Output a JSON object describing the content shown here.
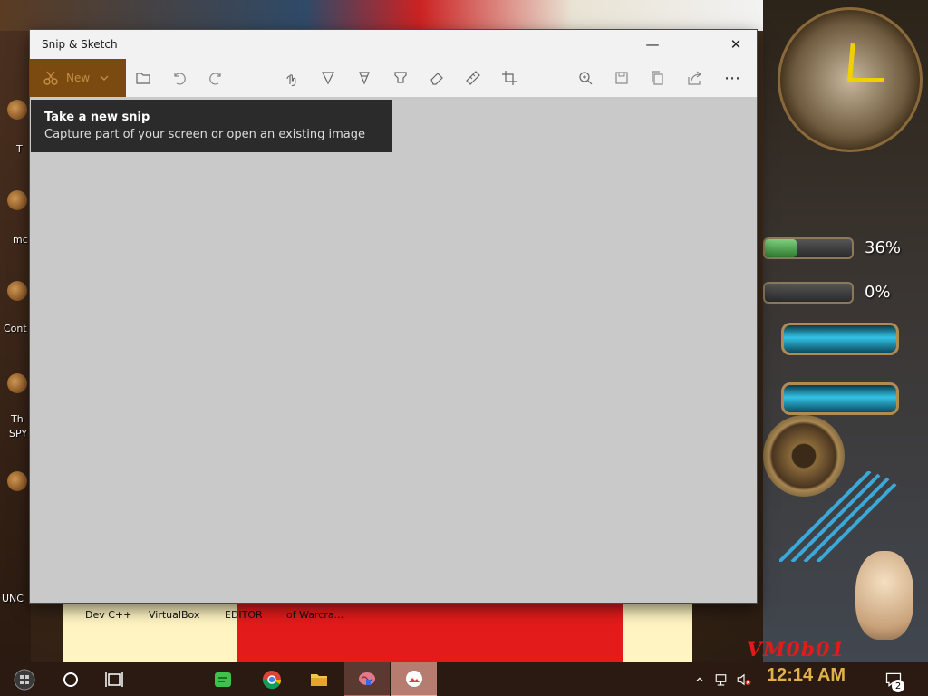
{
  "window": {
    "title": "Snip & Sketch",
    "minimize_symbol": "—",
    "close_symbol": "✕"
  },
  "toolbar": {
    "new_label": "New",
    "more_symbol": "⋯",
    "icons": [
      "open-file-icon",
      "undo-icon",
      "redo-icon",
      "touch-writing-icon",
      "ballpoint-pen-icon",
      "pencil-icon",
      "highlighter-icon",
      "eraser-icon",
      "ruler-icon",
      "crop-icon",
      "zoom-icon",
      "save-icon",
      "copy-icon",
      "share-icon",
      "more-icon"
    ]
  },
  "tooltip": {
    "title": "Take a new snip",
    "description": "Capture part of your screen or open an existing image"
  },
  "desktop": {
    "left_labels": [
      "T",
      "mc",
      "Cont",
      "Th",
      "SPY",
      "UNC"
    ],
    "bottom_labels": [
      "Dev C++",
      "VirtualBox",
      "EDITOR",
      "of Warcra..."
    ],
    "gauge1_label": "36%",
    "gauge1_value": 0.36,
    "gauge2_label": "0%",
    "gauge2_value": 0.0,
    "vm_text": "VM0b01"
  },
  "taskbar": {
    "time": "12:14 AM",
    "notification_count": "2"
  },
  "colors": {
    "accent": "#7a4a10",
    "taskbar": "#2a1a12",
    "clock_text": "#e0b04a"
  }
}
